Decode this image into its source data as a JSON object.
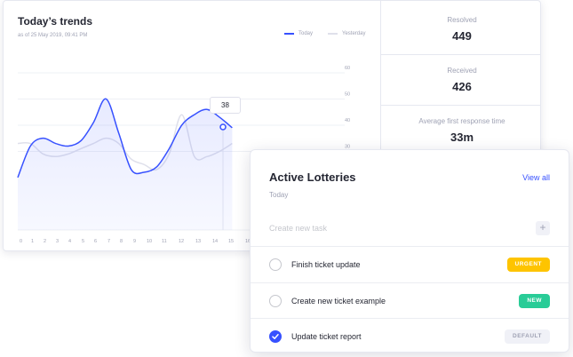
{
  "colors": {
    "accent": "#3751ff",
    "today_line": "#3751ff",
    "yesterday_line": "#dfe0eb",
    "urgent": "#fec400",
    "new": "#29cc97",
    "default_bg": "#f0f1f7",
    "default_text": "#9fa2b4"
  },
  "trends": {
    "title": "Today’s trends",
    "subtitle": "as of 25 May 2019, 09:41 PM",
    "legend_today": "Today",
    "legend_yesterday": "Yesterday",
    "tooltip_value": "38"
  },
  "stats": [
    {
      "label": "Resolved",
      "value": "449"
    },
    {
      "label": "Received",
      "value": "426"
    },
    {
      "label": "Average first response time",
      "value": "33m"
    }
  ],
  "chart_data": {
    "type": "area",
    "title": "Today’s trends",
    "x": [
      0,
      1,
      2,
      3,
      4,
      5,
      6,
      7,
      8,
      9,
      10,
      11,
      12,
      13,
      14,
      15,
      16,
      17,
      18,
      19,
      20,
      21,
      22
    ],
    "x_tick_labels": [
      "0",
      "1",
      "2",
      "3",
      "4",
      "5",
      "6",
      "7",
      "8",
      "9",
      "10",
      "11",
      "12",
      "13",
      "14",
      "15",
      "16"
    ],
    "y_tick_labels": [
      "60",
      "50",
      "40",
      "30"
    ],
    "ylim": [
      0,
      60
    ],
    "grid": true,
    "legend_position": "top-right",
    "series": [
      {
        "name": "Today",
        "values": [
          18,
          30,
          33,
          31,
          30,
          32,
          39,
          48,
          35,
          21,
          20,
          22,
          29,
          38,
          42,
          44,
          41,
          37
        ]
      },
      {
        "name": "Yesterday",
        "values": [
          31,
          31,
          27,
          26,
          27,
          29,
          31,
          33,
          31,
          25,
          23,
          21,
          27,
          42,
          26,
          26,
          28,
          31
        ]
      }
    ]
  },
  "lotteries": {
    "title": "Active Lotteries",
    "subtitle": "Today",
    "view_all": "View all",
    "new_task_placeholder": "Create new task",
    "add_symbol": "+",
    "tasks": [
      {
        "label": "Finish ticket update",
        "badge": "URGENT",
        "checked": false
      },
      {
        "label": "Create new ticket example",
        "badge": "NEW",
        "checked": false
      },
      {
        "label": "Update ticket report",
        "badge": "DEFAULT",
        "checked": true
      }
    ]
  }
}
